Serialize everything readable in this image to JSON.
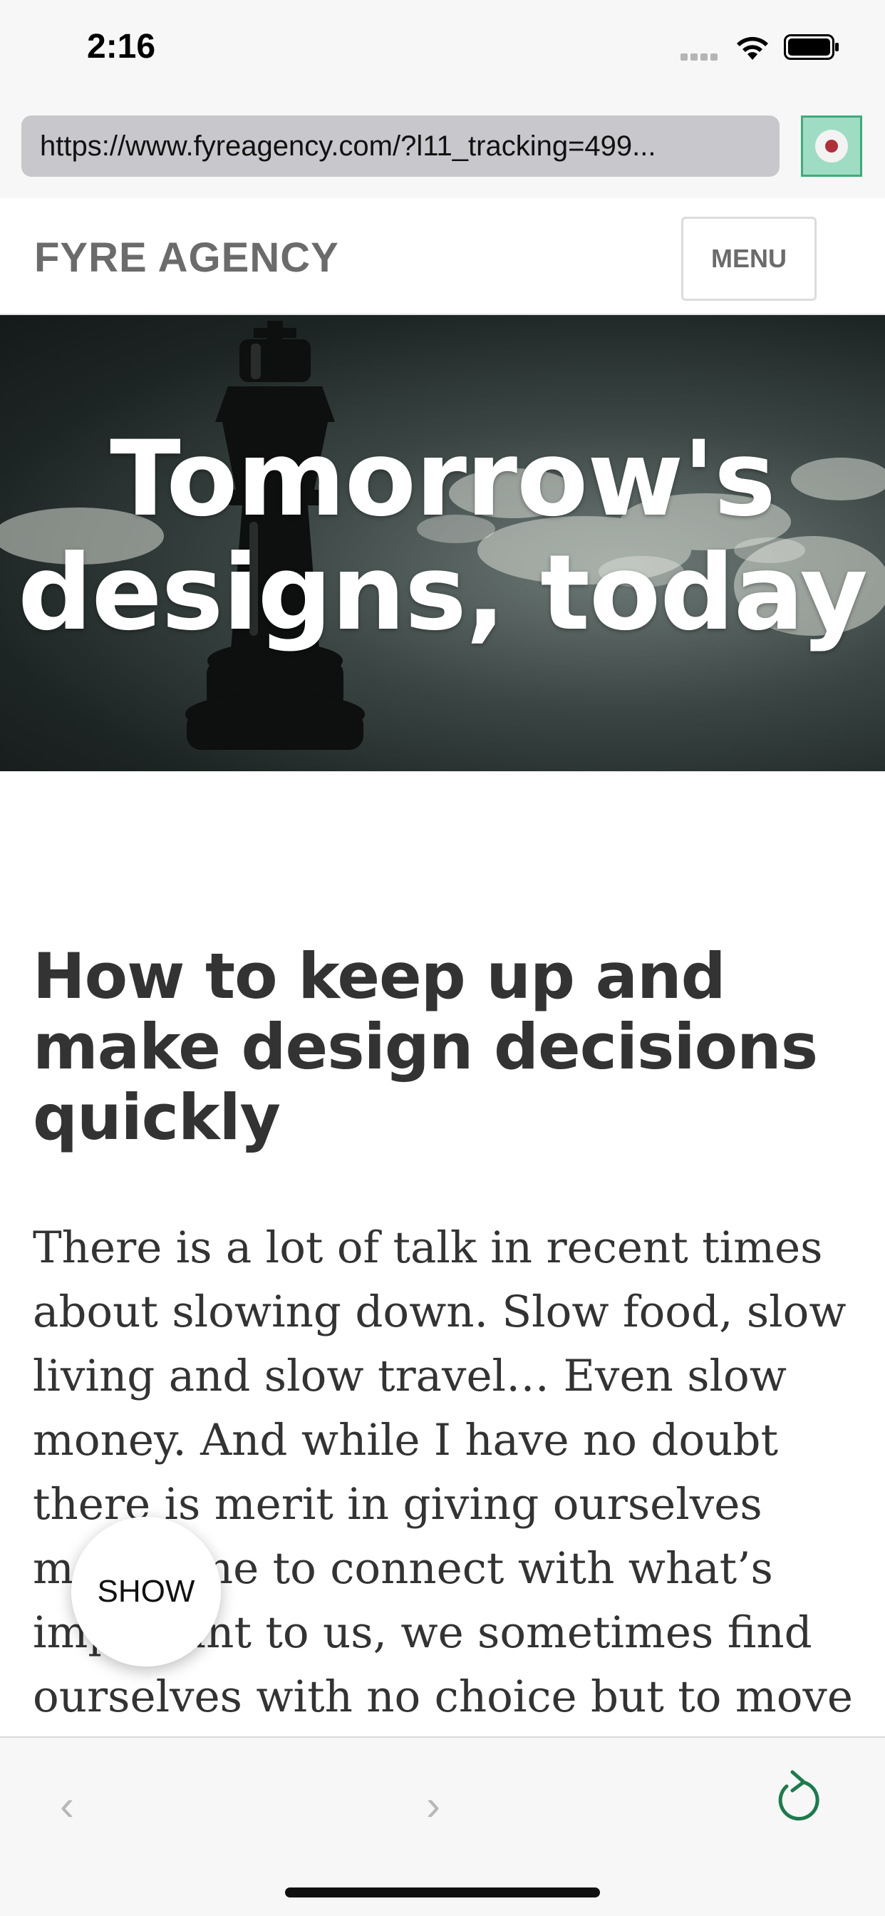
{
  "status_bar": {
    "time": "2:16"
  },
  "browser": {
    "url": "https://www.fyreagency.com/?l11_tracking=499...",
    "record_button_color": "#41a97a"
  },
  "site": {
    "title": "FYRE AGENCY",
    "menu_label": "MENU"
  },
  "hero": {
    "line1": "Tomorrow's",
    "line2": "designs, today"
  },
  "article": {
    "title": "How to keep up and make design decisions quickly",
    "body": "There is a lot of talk in recent times about slowing down. Slow food, slow living and slow travel… Even slow money. And while I have no doubt there is merit in giving ourselves more time to connect with what’s important to us, we sometimes find ourselves with no choice but to move rapidly."
  },
  "floating": {
    "show_label": "SHOW"
  },
  "toolbar": {
    "back_icon": "chevron-left-icon",
    "back_glyph": "‹",
    "forward_icon": "chevron-right-icon",
    "forward_glyph": "›",
    "reload_icon": "reload-icon",
    "accent_color": "#1e7a4e"
  }
}
